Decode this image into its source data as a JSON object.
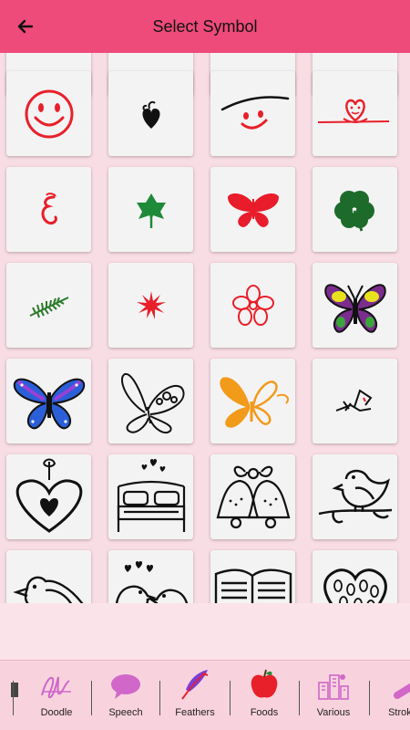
{
  "header": {
    "title": "Select Symbol"
  },
  "colors": {
    "app_bar": "#ee4a7a",
    "background": "#f9dde5",
    "tile": "#f4f3f4",
    "bottom_bar": "#f8d3de",
    "category_icon": "#d067c9"
  },
  "symbols": [
    "smiley-face",
    "heart-swirl",
    "wink-face",
    "heart-line",
    "swirl-letter",
    "green-leaf",
    "red-butterfly",
    "four-leaf-clover",
    "fern-branch",
    "red-star-flower",
    "outline-flower",
    "colorful-butterfly",
    "blue-butterfly",
    "butterfly-sketch",
    "orange-butterfly",
    "small-scribble",
    "hanging-heart",
    "bed-with-hearts",
    "wedding-bells",
    "bird-on-branch",
    "bird-sketch",
    "kissing-birds",
    "open-book",
    "heart-with-pattern"
  ],
  "categories": [
    {
      "label": "",
      "icon": "partial-icon"
    },
    {
      "label": "Doodle",
      "icon": "signature-icon"
    },
    {
      "label": "Speech",
      "icon": "speech-bubble-icon"
    },
    {
      "label": "Feathers",
      "icon": "feather-icon"
    },
    {
      "label": "Foods",
      "icon": "apple-icon"
    },
    {
      "label": "Various",
      "icon": "buildings-icon"
    },
    {
      "label": "Stroke",
      "icon": "stroke-icon"
    }
  ]
}
